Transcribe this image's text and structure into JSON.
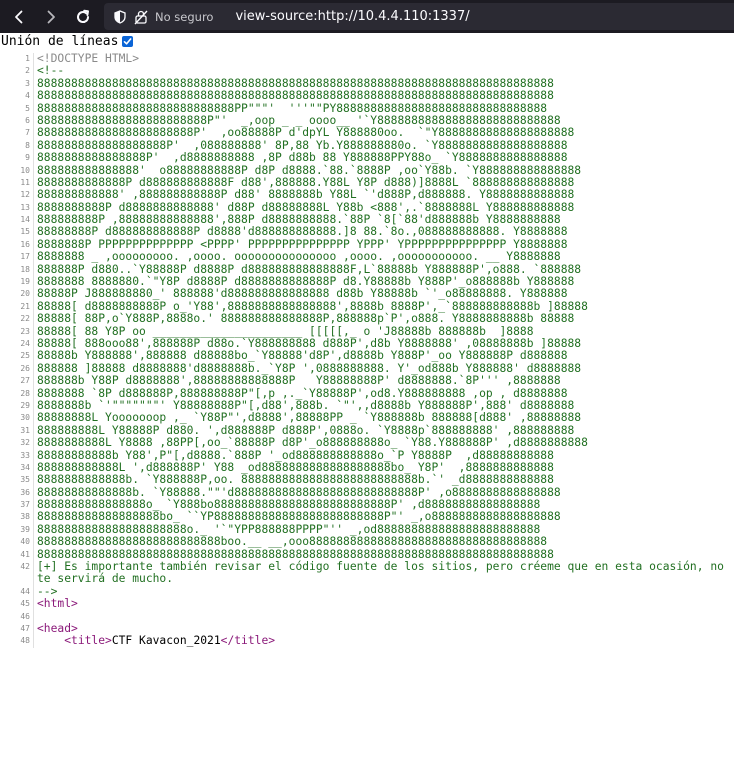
{
  "browser": {
    "url": "view-source:http://10.4.4.110:1337/",
    "insecure_label": "No seguro",
    "colors": {
      "toolbar_bg": "#1c1b22",
      "urlbar_bg": "#2b2a33"
    }
  },
  "wrap_lines": {
    "label": "Unión de líneas",
    "checked": true
  },
  "source": {
    "line_numbers": [
      "1",
      "2",
      "3",
      "4",
      "5",
      "6",
      "7",
      "8",
      "9",
      "10",
      "11",
      "12",
      "13",
      "14",
      "15",
      "16",
      "17",
      "18",
      "19",
      "20",
      "21",
      "22",
      "23",
      "24",
      "25",
      "26",
      "27",
      "28",
      "29",
      "30",
      "31",
      "32",
      "33",
      "34",
      "35",
      "36",
      "37",
      "38",
      "39",
      "40",
      "41",
      "42",
      "44",
      "45",
      "46",
      "47",
      "48"
    ],
    "lines": [
      "<!DOCTYPE HTML>",
      "<!--",
      "8888888888888888888888888888888888888888888888888888888888888888888888888888",
      "8888888888888888888888888888888888888888888888888888888888888888888888888888",
      "88888888888888888888888888888PP\"\"\"'  '''\"\"PY8888888888888888888888888888888",
      "8888888888888888888888888P\"'  _,oop _ _ oooo__ '`Y888888888888888888888888888",
      "88888888888888888888888P'  ,oo88888P d'dpYL Y888880oo.  `\"Y88888888888888888888",
      "8888888888888888888P'  ,088888888' 8P,88 Yb.Y888888880o. `Y8888888888888888888",
      "8888888888888888P'  ,d8888888888 ,8P d88b 88 Y888888PPY88o_ `Y8888888888888888",
      "888888888888888'  o88888888888P d8P d8888.`88.`8888P ,oo`Y88b. `Y888888888888888",
      "8888888888888P d888888888888F d88',888888.Y88L Y8P d888)]8888L `888888888888888",
      "888888888888' ,888888888888P d88' 8888888b Y88L `'d888P,d888888. Y8888888888888",
      "8888888888P d8888888888888' d88P d88888888L Y88b <888',.`8888888L Y888888888888",
      "888888888P ,88888888888888',888P d8888888888.`88P `8[`88'd888888b Y8888888888",
      "88888888P d888888888888P d8888'd888888888888.]8 88.`8o.,088888888888. Y8888888",
      "8888888P PPPPPPPPPPPPPP <PPPP' PPPPPPPPPPPPPPP YPPP' YPPPPPPPPPPPPPPP Y8888888",
      "8888888 _ ,ooooooooo. ,oooo. ooooooooooooooo ,oooo. ,ooooooooooo. __ Y8888888",
      "888888P d880..`Y88888P d8888P d888888888888888F,L`88888b Y888888P',o888. `888888",
      "8888888 8888880.`\"Y8P d8888P d8888888888888P d8.Y88888b Y888P'_o888888b Y888888",
      "88888P J888888880_' 888888'd888888888888888 d88b Y88888b `'_o88888888. Y888888",
      "88888[ d8888888888P o_'Y88',8888888888888888',8888b 8888P',_`888888888888b ]88888",
      "88888[ 88P,o`Y888P,8888o.' 888888888888888P,888888p`P',o888. Y8888888888b 88888",
      "88888[ 88 Y8P oo ______________________ [[[[[,_ o 'J88888b 888888b  ]8888",
      "88888[ 888ooo88',888888P d88o.`Y888888888 d888P',d8b Y8888888' ,08888888b ]88888",
      "88888b Y888888',888888 d88888bo_`Y88888'd8P',d8888b Y888P'_oo Y888888P d888888",
      "888888 ]88888 d8888888'd8888888b._`Y8P ',0888888888. Y'_od888b Y888888' d8888888",
      "888888b Y88P d8888888',88888888888888P   Y88888888P' d8888888.`8P''' ,8888888",
      "8888888 `8P d888888P,888888888P\"[,p ,._`Y88888P',od8.Y888888888 ,op , d8888888",
      "8888888b `'\"\"\"\"\"\"\"' Y88888888P\"[,d88',888b. `\"',,d8888b Y888888P',888' d8888888",
      "88888888L Yooooooop ,_ `Y88P\"',d8888',88888PP _ `Y888888b 888888[d888' ,88888888",
      "888888888L Y88888P d880. ',d888888P d888P',0888o. `Y8888p`888888888' ,888888888",
      "8888888888L Y8888 ,88PP[,oo_`88888P d8P'_o888888888o_ `Y88.Y888888P' ,d8888888888",
      "88888888888b Y88',P\"[,d8888.`888P '_od888888888888o_`P Y8888P  ,d88888888888",
      "888888888888L ',d888888P' Y88 _od8888888888888888888bo_ Y8P'  ,8888888888888",
      "8888888888888b. `Y888888P,oo. 88888888888888888888888888b.`' _d8888888888888",
      "88888888888888b. `Y88888.\"\"'d888888888888888888888888888P' ,o8888888888888888",
      "8888888888888888o_ `Y888bo88888888888888888888888888P' ,d88888888888888888",
      "888888888888888888bo_ ``YP8888888888888888888888888P\"' _,o8888888888888888888",
      "8888888888888888888888o._ '`\"YPP888888PPPP\"'' _,od888888888888888888888888",
      "888888888888888888888888888boo.__ __,ooo88888888888888888888888888888888888",
      "8888888888888888888888888888888888888888888888888888888888888888888888888888",
      "[+] Es importante también revisar el código fuente de los sitios, pero créeme que en esta ocasión, no te servirá de mucho.",
      "-->",
      "<html>",
      "",
      "<head>",
      "    <title>CTF Kavacon_2021</title>"
    ]
  }
}
